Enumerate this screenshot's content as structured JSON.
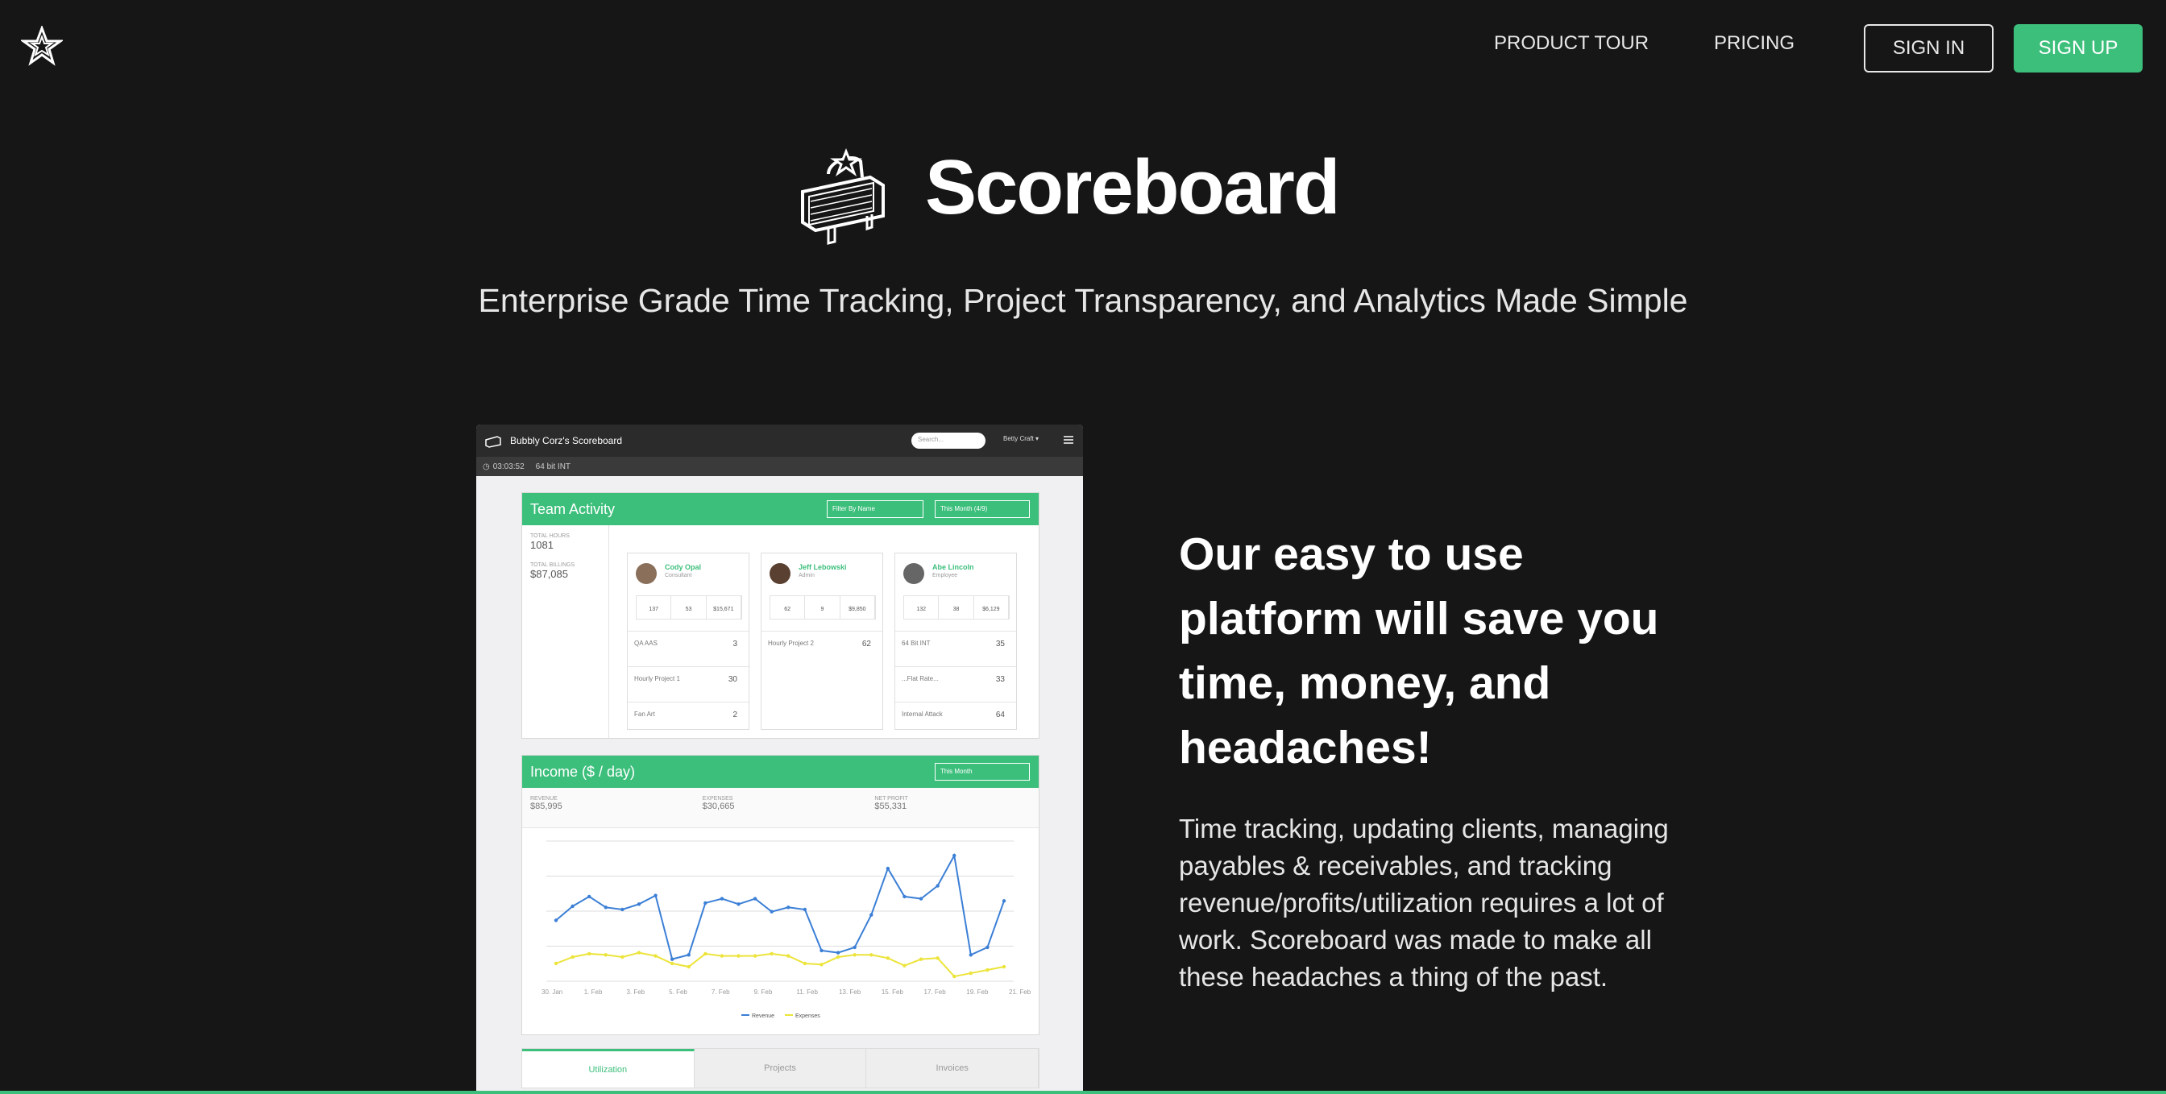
{
  "nav": {
    "product_tour": "PRODUCT TOUR",
    "pricing": "PRICING",
    "sign_in": "SIGN IN",
    "sign_up": "SIGN UP"
  },
  "hero": {
    "title": "Scoreboard",
    "tagline": "Enterprise Grade Time Tracking, Project Transparency, and Analytics Made Simple"
  },
  "feature": {
    "headline": "Our easy to use platform will save you time, money, and headaches!",
    "body": "Time tracking, updating clients, managing payables & receivables, and tracking revenue/profits/utilization requires a lot of work. Scoreboard was made to make all these headaches a thing of the past."
  },
  "mock": {
    "app_title": "Bubbly Corz's Scoreboard",
    "search_placeholder": "Search...",
    "user": "Betty Craft",
    "timer": "03:03:52",
    "project": "64 bit INT",
    "team_activity": {
      "title": "Team Activity",
      "filter_name": "Filter By Name",
      "filter_period": "This Month (4/9)",
      "total_hours_label": "TOTAL HOURS",
      "total_hours": "1081",
      "total_billings_label": "TOTAL BILLINGS",
      "total_billings": "$87,085",
      "people": [
        {
          "name": "Cody Opal",
          "role": "Consultant",
          "stats": [
            "137",
            "53",
            "$15,671"
          ],
          "projects": [
            {
              "name": "QA AAS",
              "hrs": "3"
            },
            {
              "name": "Hourly Project 1",
              "hrs": "30"
            },
            {
              "name": "Fan Art",
              "hrs": "2"
            }
          ]
        },
        {
          "name": "Jeff Lebowski",
          "role": "Admin",
          "stats": [
            "62",
            "9",
            "$9,850"
          ],
          "projects": [
            {
              "name": "Hourly Project 2",
              "hrs": "62"
            }
          ]
        },
        {
          "name": "Abe Lincoln",
          "role": "Employee",
          "stats": [
            "132",
            "38",
            "$6,129"
          ],
          "projects": [
            {
              "name": "64 Bit INT",
              "hrs": "35"
            },
            {
              "name": "...Flat Rate...",
              "hrs": "33"
            },
            {
              "name": "Internal Attack",
              "hrs": "64"
            }
          ]
        }
      ]
    },
    "income": {
      "title": "Income ($ / day)",
      "filter_period": "This Month",
      "revenue_label": "REVENUE",
      "revenue": "$85,995",
      "expenses_label": "EXPENSES",
      "expenses": "$30,665",
      "net_label": "NET PROFIT",
      "net": "$55,331",
      "x_ticks": [
        "30. Jan",
        "1. Feb",
        "3. Feb",
        "5. Feb",
        "7. Feb",
        "9. Feb",
        "11. Feb",
        "13. Feb",
        "15. Feb",
        "17. Feb",
        "19. Feb",
        "21. Feb"
      ],
      "legend_revenue": "Revenue",
      "legend_expenses": "Expenses",
      "revenue_series": [
        0.4,
        0.53,
        0.62,
        0.52,
        0.5,
        0.55,
        0.63,
        0.04,
        0.08,
        0.56,
        0.6,
        0.55,
        0.6,
        0.48,
        0.52,
        0.5,
        0.12,
        0.1,
        0.15,
        0.45,
        0.88,
        0.62,
        0.6,
        0.72,
        1.0,
        0.08,
        0.15,
        0.58
      ],
      "expenses_series": [
        0.0,
        0.06,
        0.09,
        0.08,
        0.06,
        0.1,
        0.07,
        0.0,
        -0.03,
        0.09,
        0.07,
        0.07,
        0.07,
        0.09,
        0.07,
        0.0,
        -0.01,
        0.06,
        0.08,
        0.08,
        0.05,
        -0.02,
        0.04,
        0.05,
        -0.12,
        -0.09,
        -0.06,
        -0.03
      ]
    },
    "tabs": [
      "Utilization",
      "Projects",
      "Invoices"
    ]
  },
  "colors": {
    "accent": "#3dbf7c",
    "background": "#161616",
    "revenue_line": "#3b7fd6",
    "expenses_line": "#ece43a"
  }
}
